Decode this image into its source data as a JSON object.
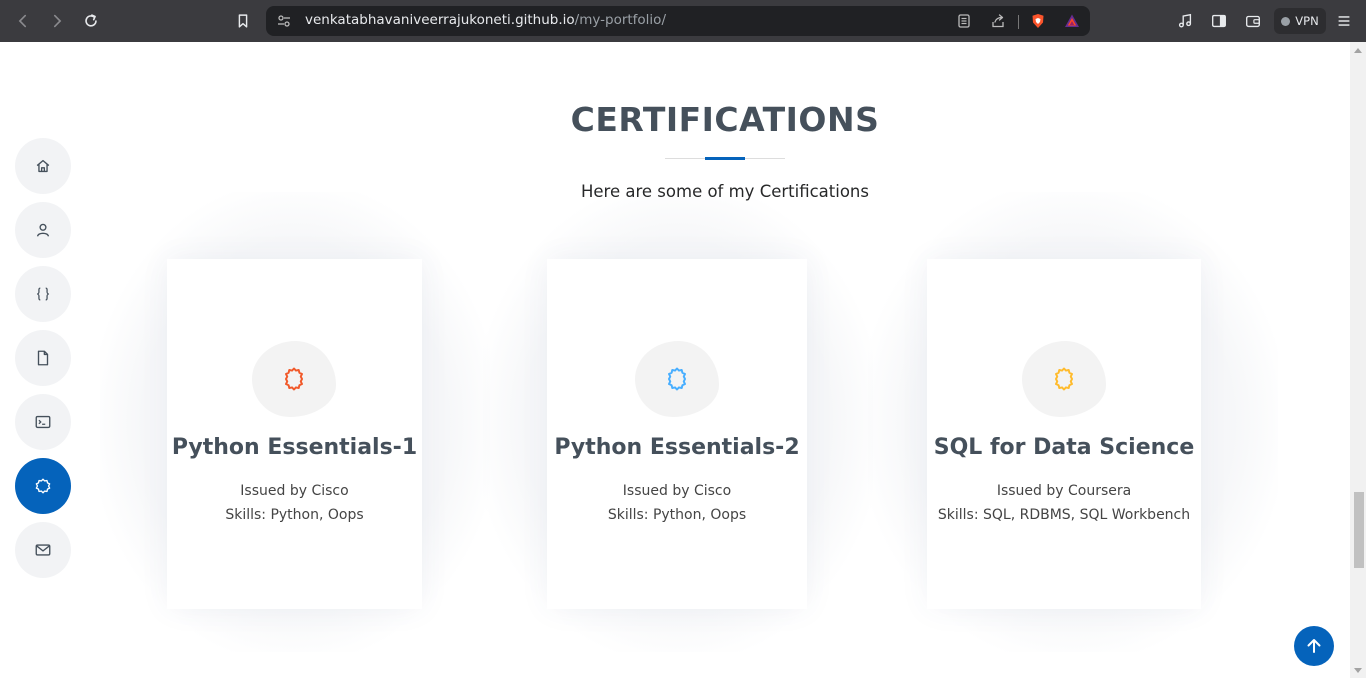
{
  "browser": {
    "url_host": "venkatabhavaniveerrajukoneti.github.io",
    "url_path": "/my-portfolio/",
    "vpn_label": "VPN"
  },
  "section": {
    "title": "CERTIFICATIONS",
    "subtitle": "Here are some of my Certifications"
  },
  "sidenav": {
    "items": [
      {
        "icon": "home-icon",
        "active": false
      },
      {
        "icon": "person-icon",
        "active": false
      },
      {
        "icon": "code-braces-icon",
        "active": false
      },
      {
        "icon": "file-icon",
        "active": false
      },
      {
        "icon": "terminal-icon",
        "active": false
      },
      {
        "icon": "certificate-icon",
        "active": true
      },
      {
        "icon": "envelope-icon",
        "active": false
      }
    ]
  },
  "cards": [
    {
      "title": "Python Essentials-1",
      "issuer": "Issued by Cisco",
      "skills": "Skills: Python, Oops",
      "icon_color": "#f1592a"
    },
    {
      "title": "Python Essentials-2",
      "issuer": "Issued by Cisco",
      "skills": "Skills: Python, Oops",
      "icon_color": "#47aeff"
    },
    {
      "title": "SQL for Data Science",
      "issuer": "Issued by Coursera",
      "skills": "Skills: SQL, RDBMS, SQL Workbench",
      "icon_color": "#ffbb2c"
    }
  ],
  "colors": {
    "accent": "#0563bb",
    "heading": "#45505b"
  }
}
